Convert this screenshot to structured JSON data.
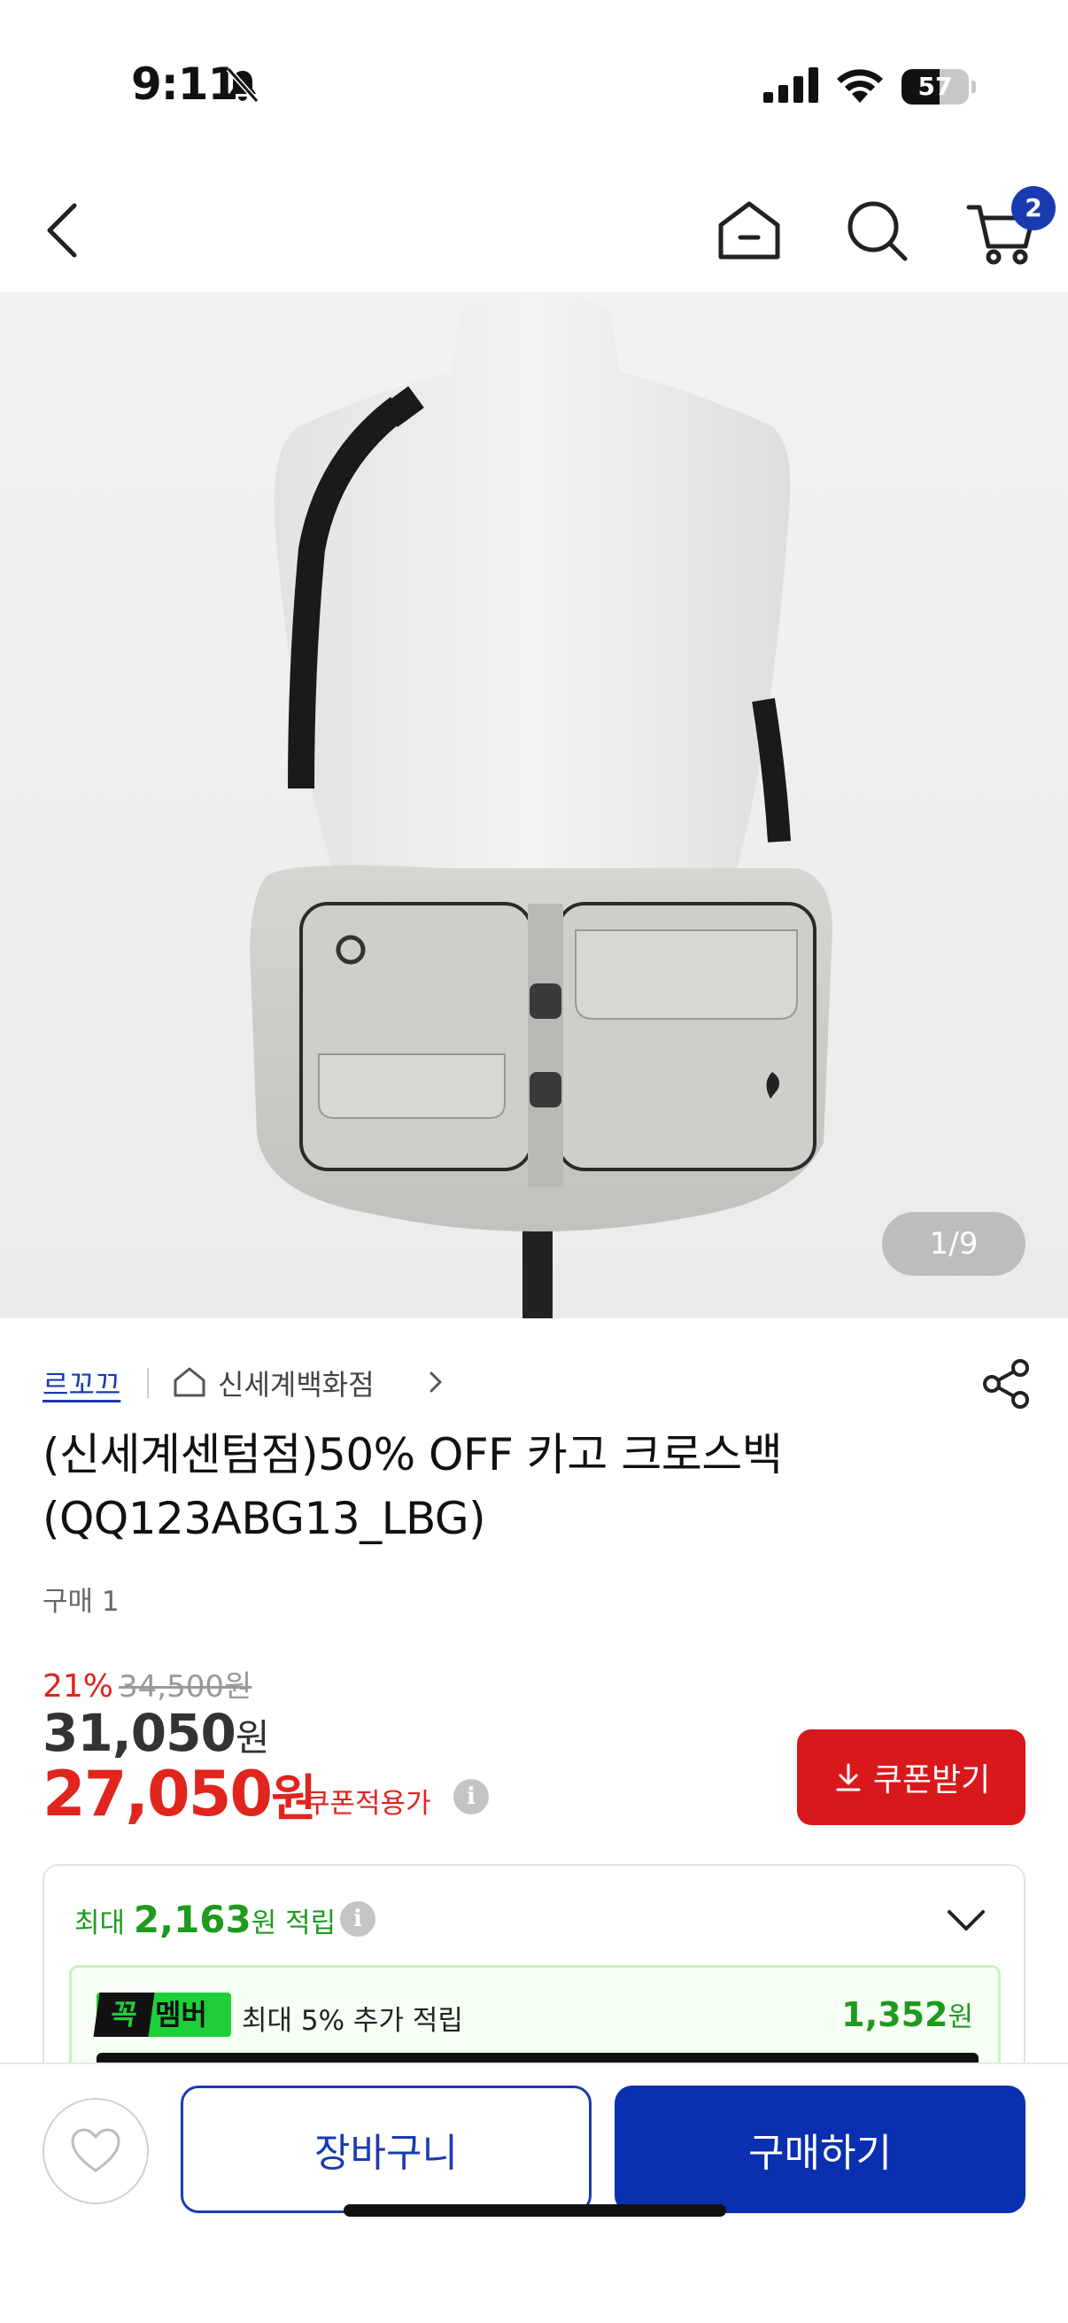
{
  "status_bar": {
    "time": "9:11",
    "battery_level": "57",
    "battery_fraction": 0.57
  },
  "nav": {
    "cart_count": "2"
  },
  "gallery": {
    "counter": "1/9",
    "current": 1,
    "total": 9
  },
  "product": {
    "brand": "르꼬끄",
    "store": "신세계백화점",
    "title_line1": "(신세계센텀점)50% OFF 카고 크로스백",
    "title_line2": "(QQ123ABG13_LBG)",
    "purchase_count": "구매 1",
    "discount_rate": "21%",
    "original_price": "34,500원",
    "sale_price": "31,050",
    "sale_price_unit": "원",
    "coupon_price": "27,050",
    "coupon_price_unit": "원",
    "coupon_note": "쿠폰적용가",
    "coupon_button": "쿠폰받기"
  },
  "points": {
    "prefix": "최대",
    "amount": "2,163",
    "suffix": "원 적립",
    "member_badge_1": "꼭",
    "member_badge_2": "멤버",
    "member_text": "최대 5% 추가 적립",
    "member_amount": "1,352",
    "member_amount_unit": "원"
  },
  "bottom": {
    "cart_label": "장바구니",
    "buy_label": "구매하기"
  },
  "colors": {
    "brand_blue": "#1a3bb0",
    "sale_red": "#e0241e",
    "points_green": "#1f9a1f"
  }
}
